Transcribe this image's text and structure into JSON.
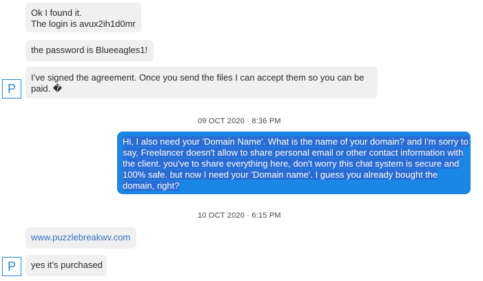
{
  "messages": {
    "m1": {
      "lines": [
        "Ok I found it.",
        "The login is avux2ih1d0mr"
      ]
    },
    "m2": {
      "text": "the password is Blueeagles1!"
    },
    "m3": {
      "lines": [
        "I’ve signed the agreement. Once you send the files I can accept them so you can be",
        "paid. �"
      ]
    },
    "m4": {
      "lines": [
        "Hi, I also need your 'Domain Name'. What is the name of your domain? and I'm sorry to",
        "say, Freelancer doesn't allow to share personal email or other contact information with",
        "the client. you've to share everything here, don't worry this chat system is secure and",
        "100% safe. but now I need your 'Domain name'. I guess you already bought the",
        "domain, right?"
      ]
    },
    "m5": {
      "text": "www.puzzlebreakwv.com"
    },
    "m6": {
      "text": "yes it’s purchased"
    }
  },
  "timestamps": {
    "t1": "09 OCT 2020 · 8:36 PM",
    "t2": "10 OCT 2020 · 6:15 PM"
  },
  "avatar": {
    "initial": "P"
  },
  "colors": {
    "incoming_bg": "#f0f0f0",
    "outgoing_bg": "#1a87e5",
    "link": "#2f73c2",
    "avatar_accent": "#1c86d8"
  }
}
